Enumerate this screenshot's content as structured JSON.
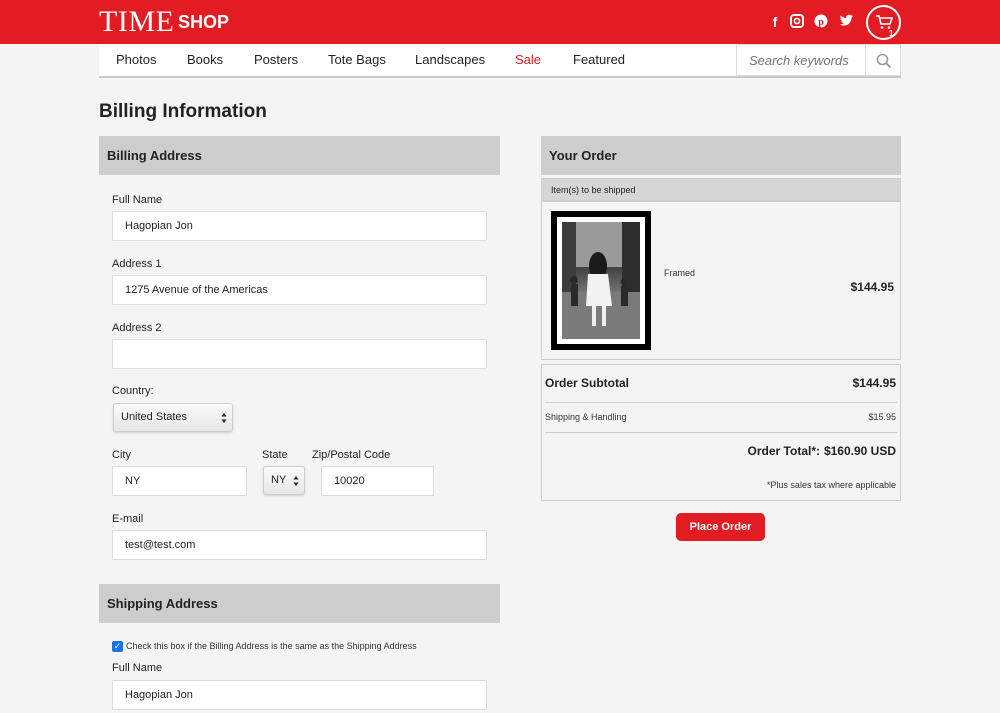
{
  "header": {
    "logo_time": "TIME",
    "logo_shop": "SHOP",
    "cart_count": "1",
    "accent": "#e31b23",
    "social_icons": [
      "facebook-icon",
      "instagram-icon",
      "pinterest-icon",
      "twitter-icon"
    ]
  },
  "nav": {
    "items": [
      "Photos",
      "Books",
      "Posters",
      "Tote Bags",
      "Landscapes",
      "Sale",
      "Featured"
    ],
    "search_placeholder": "Search keywords"
  },
  "page_title": "Billing Information",
  "billing": {
    "section_title": "Billing Address",
    "full_name_label": "Full Name",
    "full_name_value": "Hagopian Jon",
    "address1_label": "Address 1",
    "address1_value": "1275 Avenue of the Americas",
    "address2_label": "Address 2",
    "address2_value": "",
    "country_label": "Country:",
    "country_value": "United States",
    "city_label": "City",
    "city_value": "NY",
    "state_label": "State",
    "state_value": "NY",
    "zip_label": "Zip/Postal Code",
    "zip_value": "10020",
    "email_label": "E-mail",
    "email_value": "test@test.com"
  },
  "shipping": {
    "section_title": "Shipping Address",
    "same_checkbox_label": "Check this box if the Billing Address is the same as the Shipping Address",
    "same_checked": true,
    "full_name_label": "Full Name",
    "full_name_value": "Hagopian Jon"
  },
  "order": {
    "section_title": "Your Order",
    "items_header": "Item(s) to be shipped",
    "item_option": "Framed",
    "item_price": "$144.95",
    "subtotal_label": "Order Subtotal",
    "subtotal_value": "$144.95",
    "shipping_label": "Shipping & Handling",
    "shipping_value": "$15.95",
    "total_label": "Order Total*:",
    "total_value": "$160.90 USD",
    "tax_note": "*Plus sales tax where applicable",
    "place_order_label": "Place Order"
  }
}
